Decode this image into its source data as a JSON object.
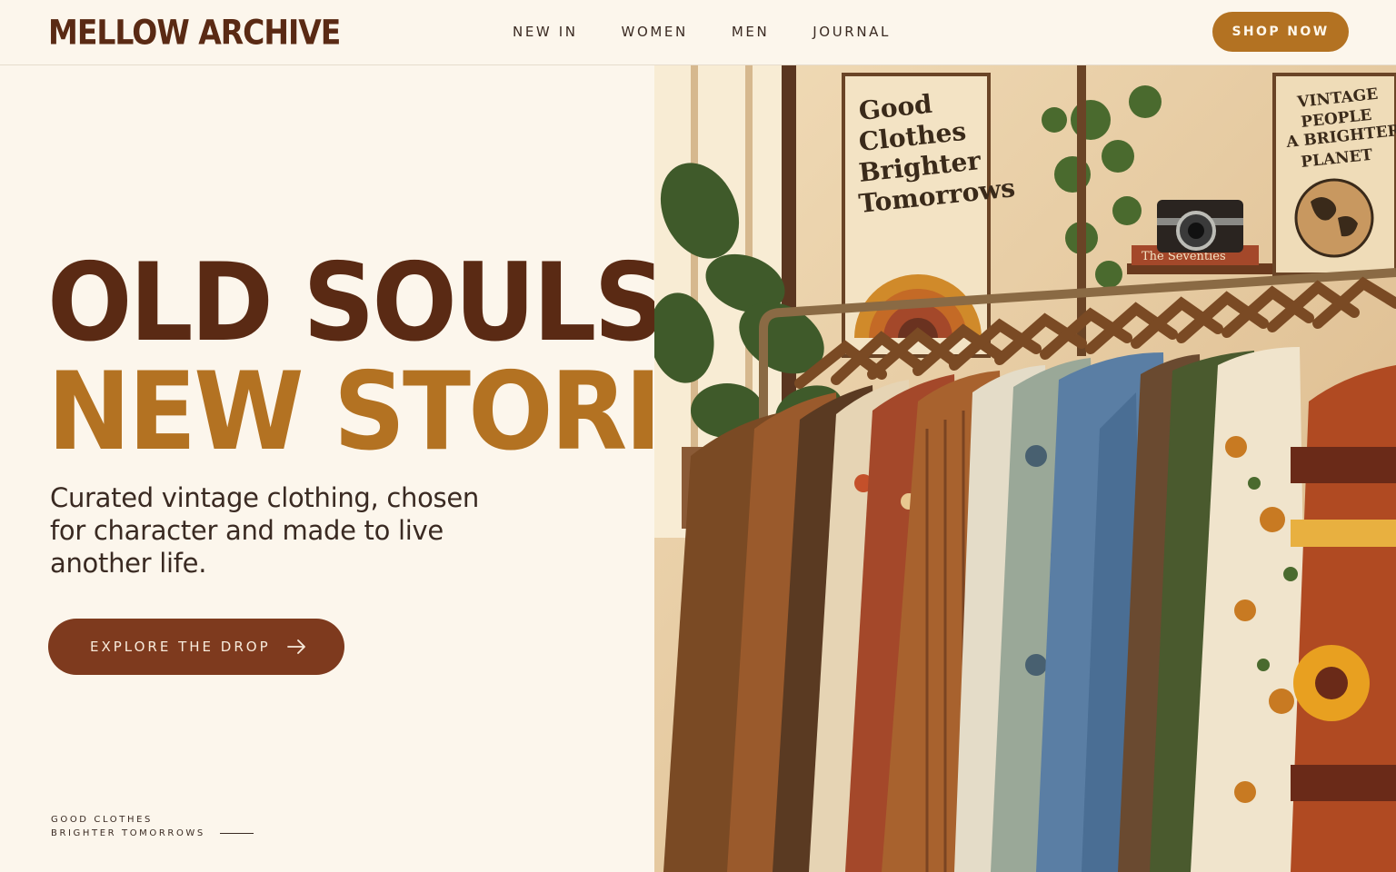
{
  "header": {
    "logo": "MELLOW ARCHIVE",
    "nav": [
      "NEW IN",
      "WOMEN",
      "MEN",
      "JOURNAL"
    ],
    "shop_button": "SHOP NOW"
  },
  "hero": {
    "headline_line1": "OLD SOULS.",
    "headline_line2": "NEW STORIES.",
    "subcopy": "Curated vintage clothing, chosen for character and made to live another life.",
    "cta_label": "EXPLORE THE DROP",
    "tagline_line1": "GOOD CLOTHES",
    "tagline_line2": "BRIGHTER TOMORROWS"
  },
  "image": {
    "poster_left": [
      "Good",
      "Clothes",
      "Brighter",
      "Tomorrows"
    ],
    "poster_right": [
      "VINTAGE",
      "PEOPLE",
      "A BRIGHTER",
      "PLANET"
    ],
    "book_title": "The Seventies"
  },
  "colors": {
    "background": "#fcf6ec",
    "brown": "#5a2a14",
    "mustard": "#b37222",
    "rust": "#7e3a1e"
  }
}
